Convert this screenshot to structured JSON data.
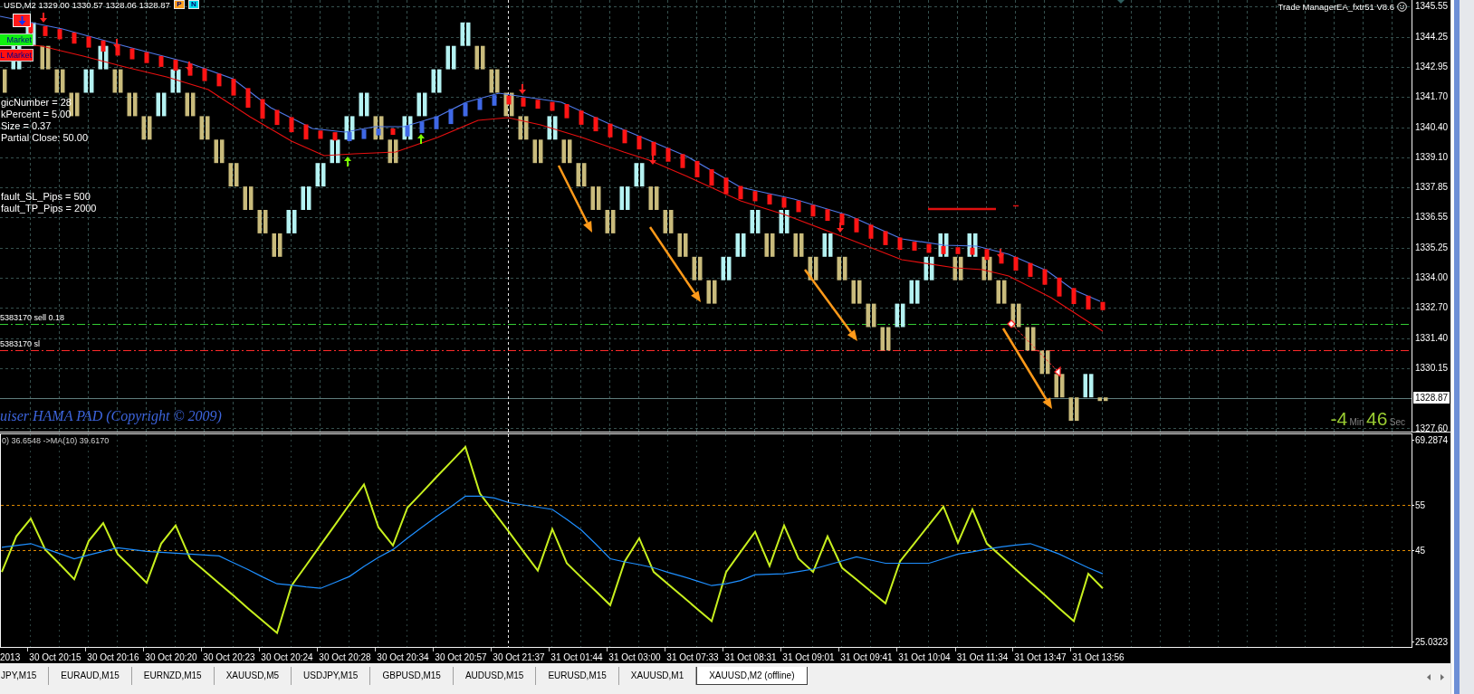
{
  "chart": {
    "title_text": "USD,M2 1329.00 1330.57 1328.06 1328.87",
    "title_buttons": [
      {
        "label": "P",
        "color": "#ffa020"
      },
      {
        "label": "N",
        "color": "#00e0f0"
      }
    ],
    "expert_label": "Trade ManagerEA_fxtr51 V8.6",
    "trade_panel": [
      {
        "kind": "arrow"
      },
      {
        "kind": "buy",
        "label": "Market"
      },
      {
        "kind": "sell",
        "label": "L Market"
      }
    ],
    "settings_groups": [
      [
        "gicNumber = 28",
        "kPercent = 5.00",
        "Size = 0.37",
        "Partial Close: 50.00"
      ],
      [
        "fault_SL_Pips = 500",
        "fault_TP_Pips = 2000"
      ]
    ],
    "order_lines": [
      {
        "kind": "entry",
        "label": "5383170 sell 0.18"
      },
      {
        "kind": "stop_loss",
        "label": "5383170 sl"
      }
    ],
    "indicator_caption": "uiser HAMA PAD (Copyright © 2009)",
    "countdown": {
      "minutes": "-4",
      "minutes_unit": "Min",
      "seconds": "46",
      "seconds_unit": "Sec"
    },
    "price_axis": [
      {
        "kind": "grid",
        "label": "1345.55"
      },
      {
        "kind": "grid",
        "label": "1344.25"
      },
      {
        "kind": "grid",
        "label": "1342.95"
      },
      {
        "kind": "grid",
        "label": "1341.70"
      },
      {
        "kind": "grid",
        "label": "1340.40"
      },
      {
        "kind": "grid",
        "label": "1339.10"
      },
      {
        "kind": "grid",
        "label": "1337.85"
      },
      {
        "kind": "grid",
        "label": "1336.55"
      },
      {
        "kind": "grid",
        "label": "1335.25"
      },
      {
        "kind": "grid",
        "label": "1334.00"
      },
      {
        "kind": "grid",
        "label": "1332.70"
      },
      {
        "kind": "grid",
        "label": "1331.40"
      },
      {
        "kind": "grid",
        "label": "1330.15"
      },
      {
        "kind": "current",
        "label": "1328.87"
      },
      {
        "kind": "grid",
        "label": "1327.60"
      }
    ]
  },
  "oscillator": {
    "header": "0) 36.6548 ->MA(10) 39.6170",
    "cut_time_label": "2013",
    "chart_data": {
      "type": "line",
      "grid": true,
      "categories": [
        null,
        null,
        null,
        null,
        "30 Oct 20:15",
        null,
        null,
        null,
        "30 Oct 20:16",
        null,
        null,
        null,
        "30 Oct 20:20",
        null,
        null,
        null,
        "30 Oct 20:23",
        null,
        null,
        null,
        "30 Oct 20:24",
        null,
        null,
        null,
        "30 Oct 20:28",
        null,
        null,
        null,
        "30 Oct 20:34",
        null,
        null,
        null,
        "30 Oct 20:57",
        null,
        null,
        null,
        "30 Oct 21:37",
        null,
        null,
        null,
        "31 Oct 01:44",
        null,
        null,
        null,
        "31 Oct 03:00",
        null,
        null,
        null,
        "31 Oct 07:33",
        null,
        null,
        null,
        "31 Oct 08:31",
        null,
        null,
        null,
        "31 Oct 09:01",
        null,
        null,
        null,
        "31 Oct 09:41",
        null,
        null,
        null,
        "31 Oct 10:04",
        null,
        null,
        null,
        "31 Oct 11:34",
        null,
        null,
        null,
        "31 Oct 13:47",
        null,
        null,
        null,
        "31 Oct 13:56"
      ],
      "series": [
        {
          "color": "#c8f01e",
          "values": [
            40.3,
            48.1,
            52.0,
            45.2,
            42.0,
            38.7,
            47.1,
            51.0,
            44.2,
            41.1,
            37.9,
            46.5,
            50.5,
            43.2,
            40.5,
            37.8,
            35.1,
            32.3,
            29.6,
            26.9,
            37.3,
            41.7,
            46.2,
            50.6,
            55.1,
            59.5,
            50.1,
            46.1,
            54.4,
            57.7,
            61.1,
            64.4,
            67.7,
            57.5,
            53.3,
            49.1,
            44.8,
            40.6,
            49.7,
            42.2,
            39.1,
            36.1,
            33.0,
            42.6,
            47.7,
            40.3,
            37.6,
            34.9,
            32.2,
            29.5,
            40.3,
            44.7,
            49.1,
            41.6,
            50.5,
            43.2,
            40.3,
            48.1,
            41.2,
            38.6,
            36.0,
            33.4,
            42.6,
            46.6,
            50.6,
            54.6,
            46.7,
            54.0,
            46.5,
            43.7,
            40.8,
            38.0,
            35.2,
            32.3,
            29.5,
            39.9,
            36.7
          ]
        },
        {
          "color": "#1e8fff",
          "values": [
            45.7,
            46.1,
            46.5,
            45.4,
            44.3,
            43.2,
            44.0,
            44.8,
            45.6,
            45.2,
            44.8,
            44.6,
            44.4,
            44.2,
            44.0,
            43.8,
            42.3,
            40.8,
            39.2,
            37.7,
            37.4,
            37.0,
            36.7,
            38.0,
            39.3,
            41.5,
            43.5,
            45.2,
            47.7,
            50.1,
            52.4,
            54.6,
            56.9,
            56.9,
            56.5,
            55.5,
            55.0,
            54.5,
            54.0,
            51.8,
            49.5,
            46.4,
            43.2,
            42.5,
            41.9,
            41.2,
            40.2,
            39.3,
            38.3,
            37.3,
            37.7,
            38.4,
            39.7,
            39.8,
            39.9,
            40.4,
            40.9,
            41.8,
            42.7,
            43.6,
            42.9,
            42.2,
            42.2,
            42.2,
            42.2,
            43.2,
            44.2,
            44.7,
            45.3,
            45.8,
            46.2,
            46.5,
            45.4,
            44.2,
            42.7,
            41.2,
            39.9
          ]
        }
      ],
      "ylim": [
        23.74,
        70.58
      ],
      "yticks": [
        {
          "value": 69.2874,
          "label": "69.2874"
        },
        {
          "value": 55,
          "label": "55"
        },
        {
          "value": 45,
          "label": "45"
        },
        {
          "value": 25.0323,
          "label": "25.0323"
        }
      ]
    }
  },
  "symbol_tabs": [
    {
      "label": "JPY,M15",
      "selected": false
    },
    {
      "label": "EURAUD,M15",
      "selected": false
    },
    {
      "label": "EURNZD,M15",
      "selected": false
    },
    {
      "label": "XAUUSD,M5",
      "selected": false
    },
    {
      "label": "USDJPY,M15",
      "selected": false
    },
    {
      "label": "GBPUSD,M15",
      "selected": false
    },
    {
      "label": "AUDUSD,M15",
      "selected": false
    },
    {
      "label": "EURUSD,M15",
      "selected": false
    },
    {
      "label": "XAUUSD,M1",
      "selected": false
    },
    {
      "label": "XAUUSD,M2 (offline)",
      "selected": true
    }
  ]
}
